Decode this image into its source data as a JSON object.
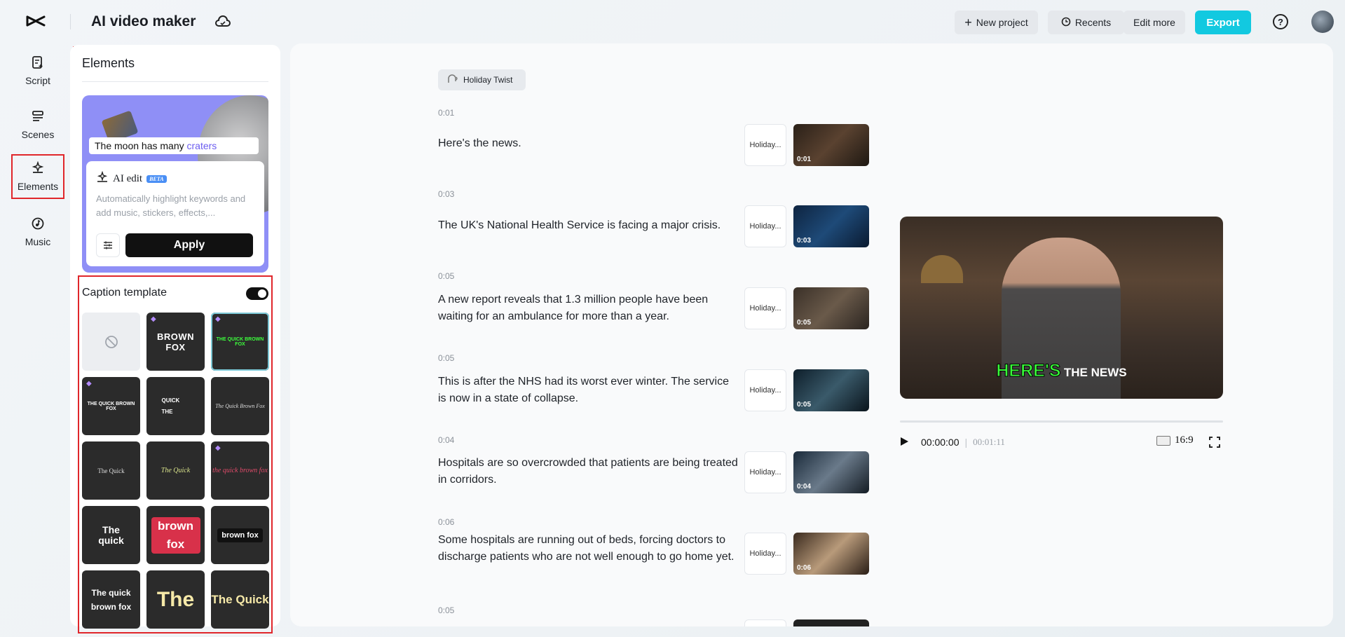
{
  "header": {
    "app_title": "AI video maker",
    "new_project": "New project",
    "recents": "Recents",
    "edit_more": "Edit more",
    "export": "Export"
  },
  "rail": {
    "script": "Script",
    "scenes": "Scenes",
    "elements": "Elements",
    "music": "Music"
  },
  "panel": {
    "title": "Elements",
    "promo_caption_a": "The moon has many ",
    "promo_caption_b": "craters",
    "ai_edit_label": "AI edit",
    "beta_badge": "BETA",
    "ai_desc": "Automatically highlight keywords and add music, stickers, effects,...",
    "apply": "Apply",
    "caption_template_title": "Caption template",
    "tiles": [
      "",
      "BROWN FOX",
      "THE QUICK BROWN FOX",
      "THE QUICK BROWN FOX",
      "QUICK THE",
      "The Quick Brown Fox",
      "The Quick",
      "The Quick",
      "the quick brown fox",
      "The quick",
      "brown fox",
      "brown fox",
      "The quick brown fox",
      "The",
      "The Quick"
    ]
  },
  "script": {
    "voice_tag": "Holiday Twist",
    "chip_label": "Holiday...",
    "lines": [
      {
        "time": "0:01",
        "text": "Here's the news.",
        "thumb": "0:01"
      },
      {
        "time": "0:03",
        "text": "The UK's National Health Service is facing a major crisis.",
        "thumb": "0:03"
      },
      {
        "time": "0:05",
        "text": "A new report reveals that 1.3 million people have been waiting for an ambulance for more than a year.",
        "thumb": "0:05"
      },
      {
        "time": "0:05",
        "text": "This is after the NHS had its worst ever winter. The service is now in a state of collapse.",
        "thumb": "0:05"
      },
      {
        "time": "0:04",
        "text": "Hospitals are so overcrowded that patients are being treated in corridors.",
        "thumb": "0:04"
      },
      {
        "time": "0:06",
        "text": "Some hospitals are running out of beds, forcing doctors to discharge patients who are not well enough to go home yet.",
        "thumb": "0:06"
      },
      {
        "time": "0:05",
        "text": "",
        "thumb": ""
      }
    ]
  },
  "preview": {
    "subtitle_highlight": "HERE'S",
    "subtitle_rest": "THE NEWS",
    "current_time": "00:00:00",
    "duration": "00:01:11",
    "aspect_ratio": "16:9",
    "playback_progress": 0.0
  },
  "icons": {
    "logo": "capcut-logo-icon",
    "cloud": "cloud-icon",
    "plus": "plus-icon",
    "clock": "clock-icon",
    "help": "help-icon",
    "play": "play-icon",
    "fullscreen": "fullscreen-icon"
  },
  "colors": {
    "accent": "#12c9e0",
    "highlight_box": "#e0262b",
    "subtitle_highlight": "#39ff3a"
  }
}
